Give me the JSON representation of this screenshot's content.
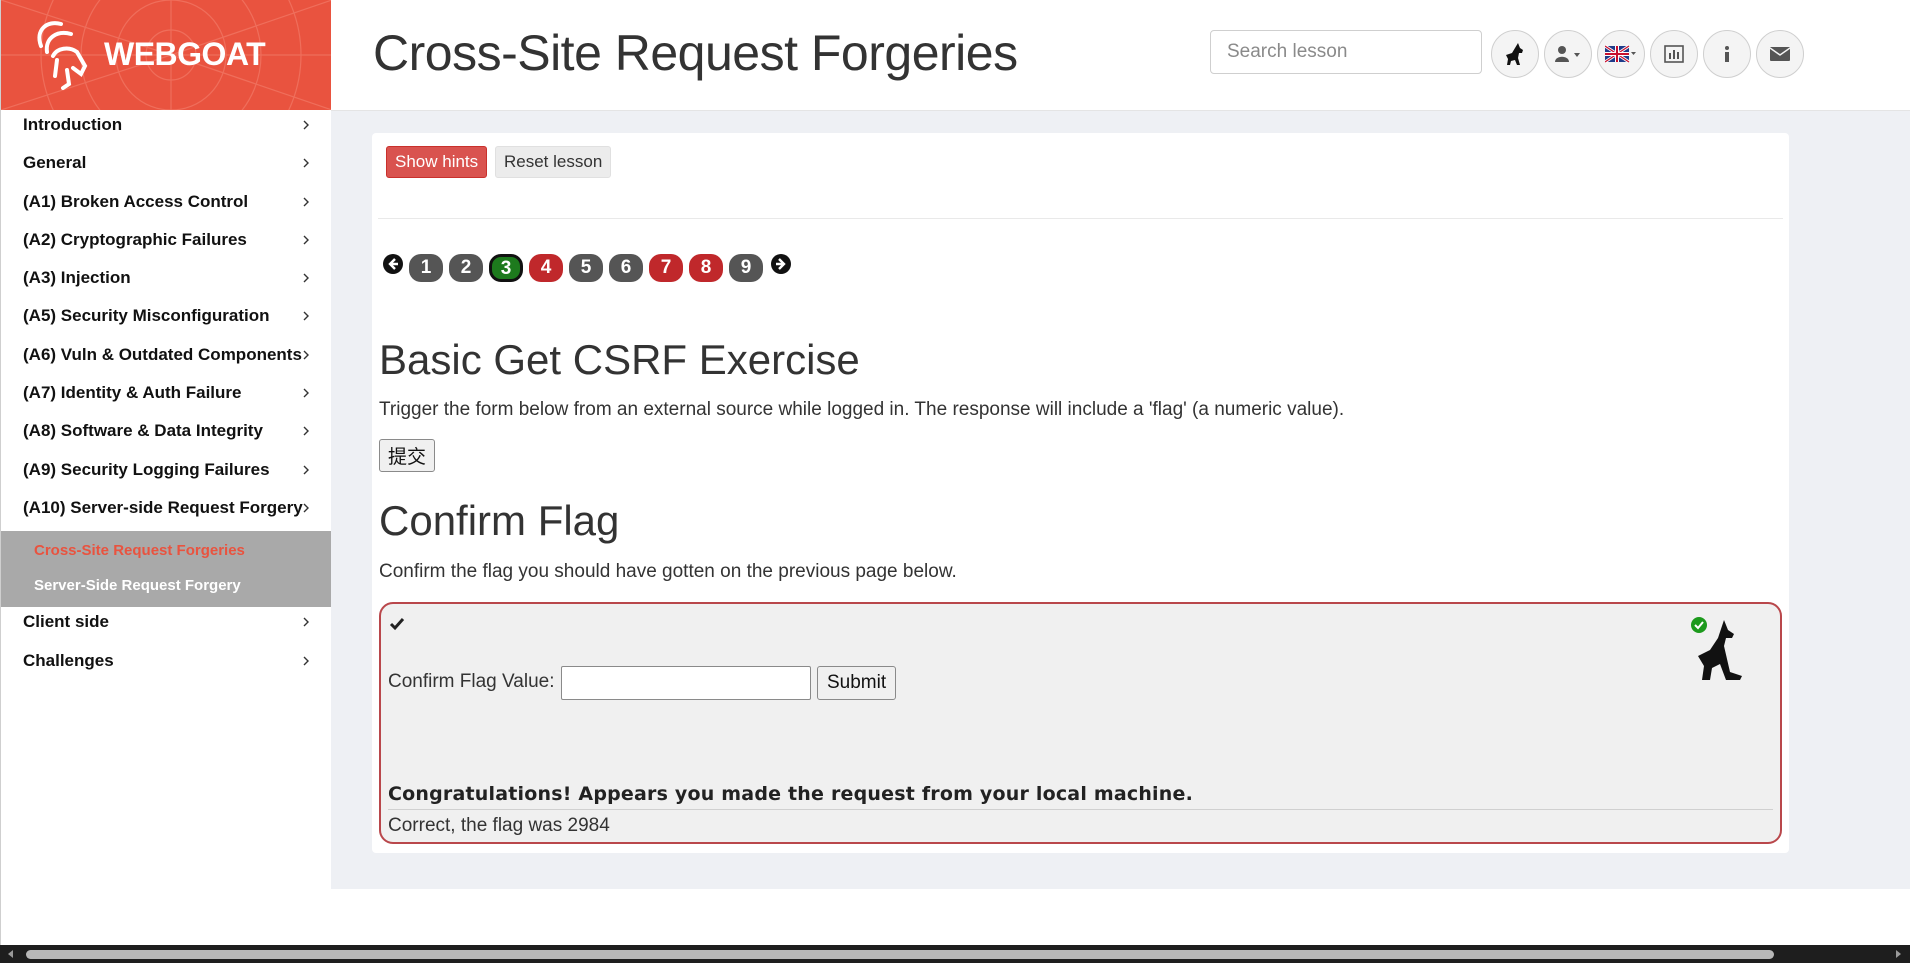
{
  "brand": {
    "name": "WEBGOAT",
    "logo": "goat-logo-icon"
  },
  "header": {
    "title": "Cross-Site Request Forgeries",
    "search_placeholder": "Search lesson",
    "buttons": [
      {
        "name": "wolf-icon"
      },
      {
        "name": "user-icon"
      },
      {
        "name": "uk-flag-icon"
      },
      {
        "name": "report-card-icon"
      },
      {
        "name": "info-icon"
      },
      {
        "name": "envelope-icon"
      }
    ]
  },
  "sidebar": {
    "items": [
      {
        "label": "Introduction"
      },
      {
        "label": "General"
      },
      {
        "label": "(A1) Broken Access Control"
      },
      {
        "label": "(A2) Cryptographic Failures"
      },
      {
        "label": "(A3) Injection"
      },
      {
        "label": "(A5) Security Misconfiguration"
      },
      {
        "label": "(A6) Vuln & Outdated Components"
      },
      {
        "label": "(A7) Identity & Auth Failure"
      },
      {
        "label": "(A8) Software & Data Integrity"
      },
      {
        "label": "(A9) Security Logging Failures"
      },
      {
        "label": "(A10) Server-side Request Forgery"
      }
    ],
    "subitems": [
      {
        "label": "Cross-Site Request Forgeries",
        "active": true
      },
      {
        "label": "Server-Side Request Forgery",
        "active": false
      }
    ],
    "items_after": [
      {
        "label": "Client side"
      },
      {
        "label": "Challenges"
      }
    ]
  },
  "lesson": {
    "show_hints": "Show hints",
    "reset_lesson": "Reset lesson",
    "pages": [
      {
        "n": "1",
        "state": "grey"
      },
      {
        "n": "2",
        "state": "grey"
      },
      {
        "n": "3",
        "state": "green"
      },
      {
        "n": "4",
        "state": "red"
      },
      {
        "n": "5",
        "state": "grey"
      },
      {
        "n": "6",
        "state": "grey"
      },
      {
        "n": "7",
        "state": "red"
      },
      {
        "n": "8",
        "state": "red"
      },
      {
        "n": "9",
        "state": "grey"
      }
    ],
    "exercise_title": "Basic Get CSRF Exercise",
    "exercise_text": "Trigger the form below from an external source while logged in. The response will include a 'flag' (a numeric value).",
    "exercise_button": "提交",
    "confirm_title": "Confirm Flag",
    "confirm_text": "Confirm the flag you should have gotten on the previous page below.",
    "flag_label": "Confirm Flag Value:",
    "flag_value": "",
    "submit_label": "Submit",
    "feedback": "Congratulations! Appears you made the request from your local machine.",
    "output": "Correct, the flag was 2984"
  },
  "colors": {
    "brand": "#e9533f",
    "success": "#1d7a1d",
    "danger": "#c0282b"
  }
}
